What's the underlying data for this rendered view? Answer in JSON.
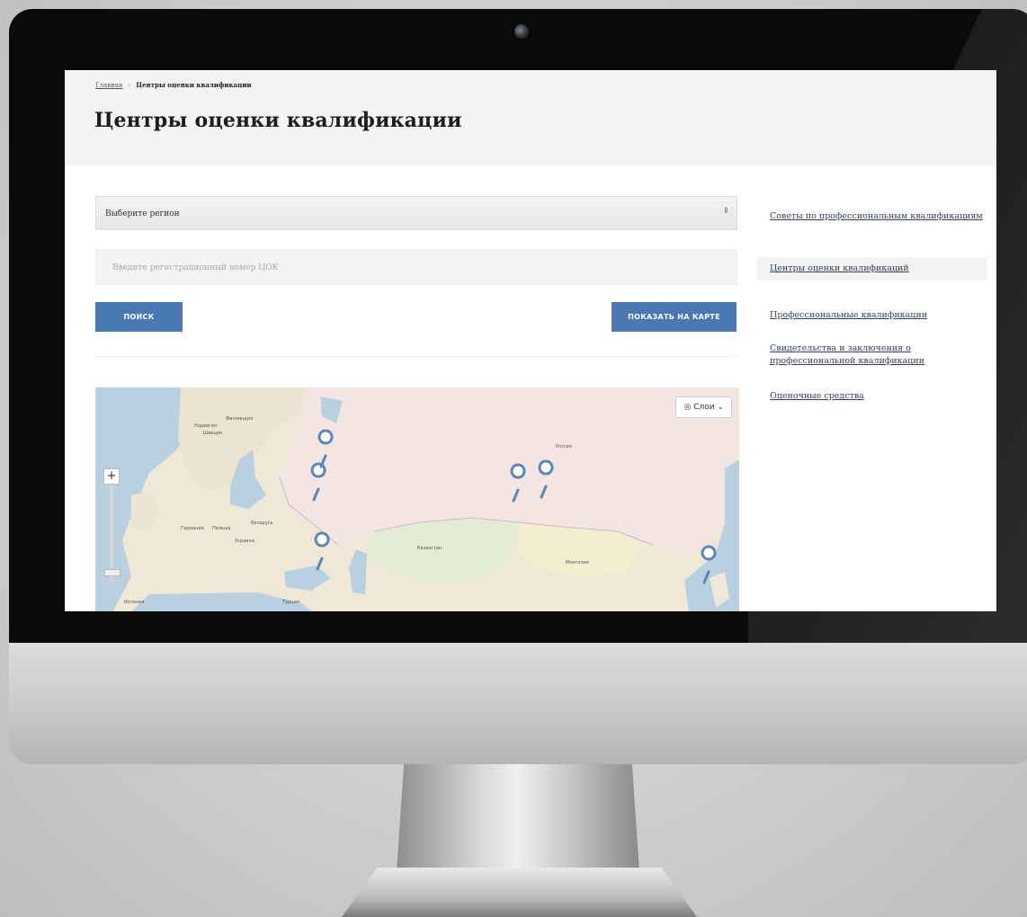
{
  "breadcrumb": {
    "home": "Главная",
    "current": "Центры оценки квалификации"
  },
  "page": {
    "title": "Центры оценки квалификации"
  },
  "search_form": {
    "region_select": "Выберите регион",
    "reg_number_placeholder": "Введите регистрационный номер ЦОК",
    "search_button": "ПОИСК",
    "show_map_button": "ПОКАЗАТЬ НА КАРТЕ"
  },
  "map": {
    "layers_button": "Слои",
    "zoom_in": "+",
    "labels": {
      "finland": "Финляндия",
      "sweden": "Швеция",
      "norway": "Норвегия",
      "russia": "Россия",
      "belarus": "Беларусь",
      "ukraine": "Украина",
      "poland": "Польша",
      "germany": "Германия",
      "kazakhstan": "Казахстан",
      "mongolia": "Монголия",
      "spain": "Испания",
      "turkey": "Турция"
    },
    "colors": {
      "water": "#b9d0e0",
      "land": "#efe8d7",
      "russia": "#f3e6e2",
      "kazakhstan": "#e4ecd3",
      "mongolia": "#f1efd0",
      "marker": "#5a86b8"
    }
  },
  "sidebar": {
    "items": [
      {
        "label": "Советы по профессиональным квалификациям",
        "active": false
      },
      {
        "label": "Центры оценки квалификаций",
        "active": true
      },
      {
        "label": "Профессиональные квалификации",
        "active": false
      },
      {
        "label": "Свидетельства и заключения о профессиональной квалификации",
        "active": false
      },
      {
        "label": "Оценочные средства",
        "active": false
      }
    ]
  },
  "theme": {
    "accent": "#4a78b4",
    "header_bg": "#f4f4f2"
  }
}
